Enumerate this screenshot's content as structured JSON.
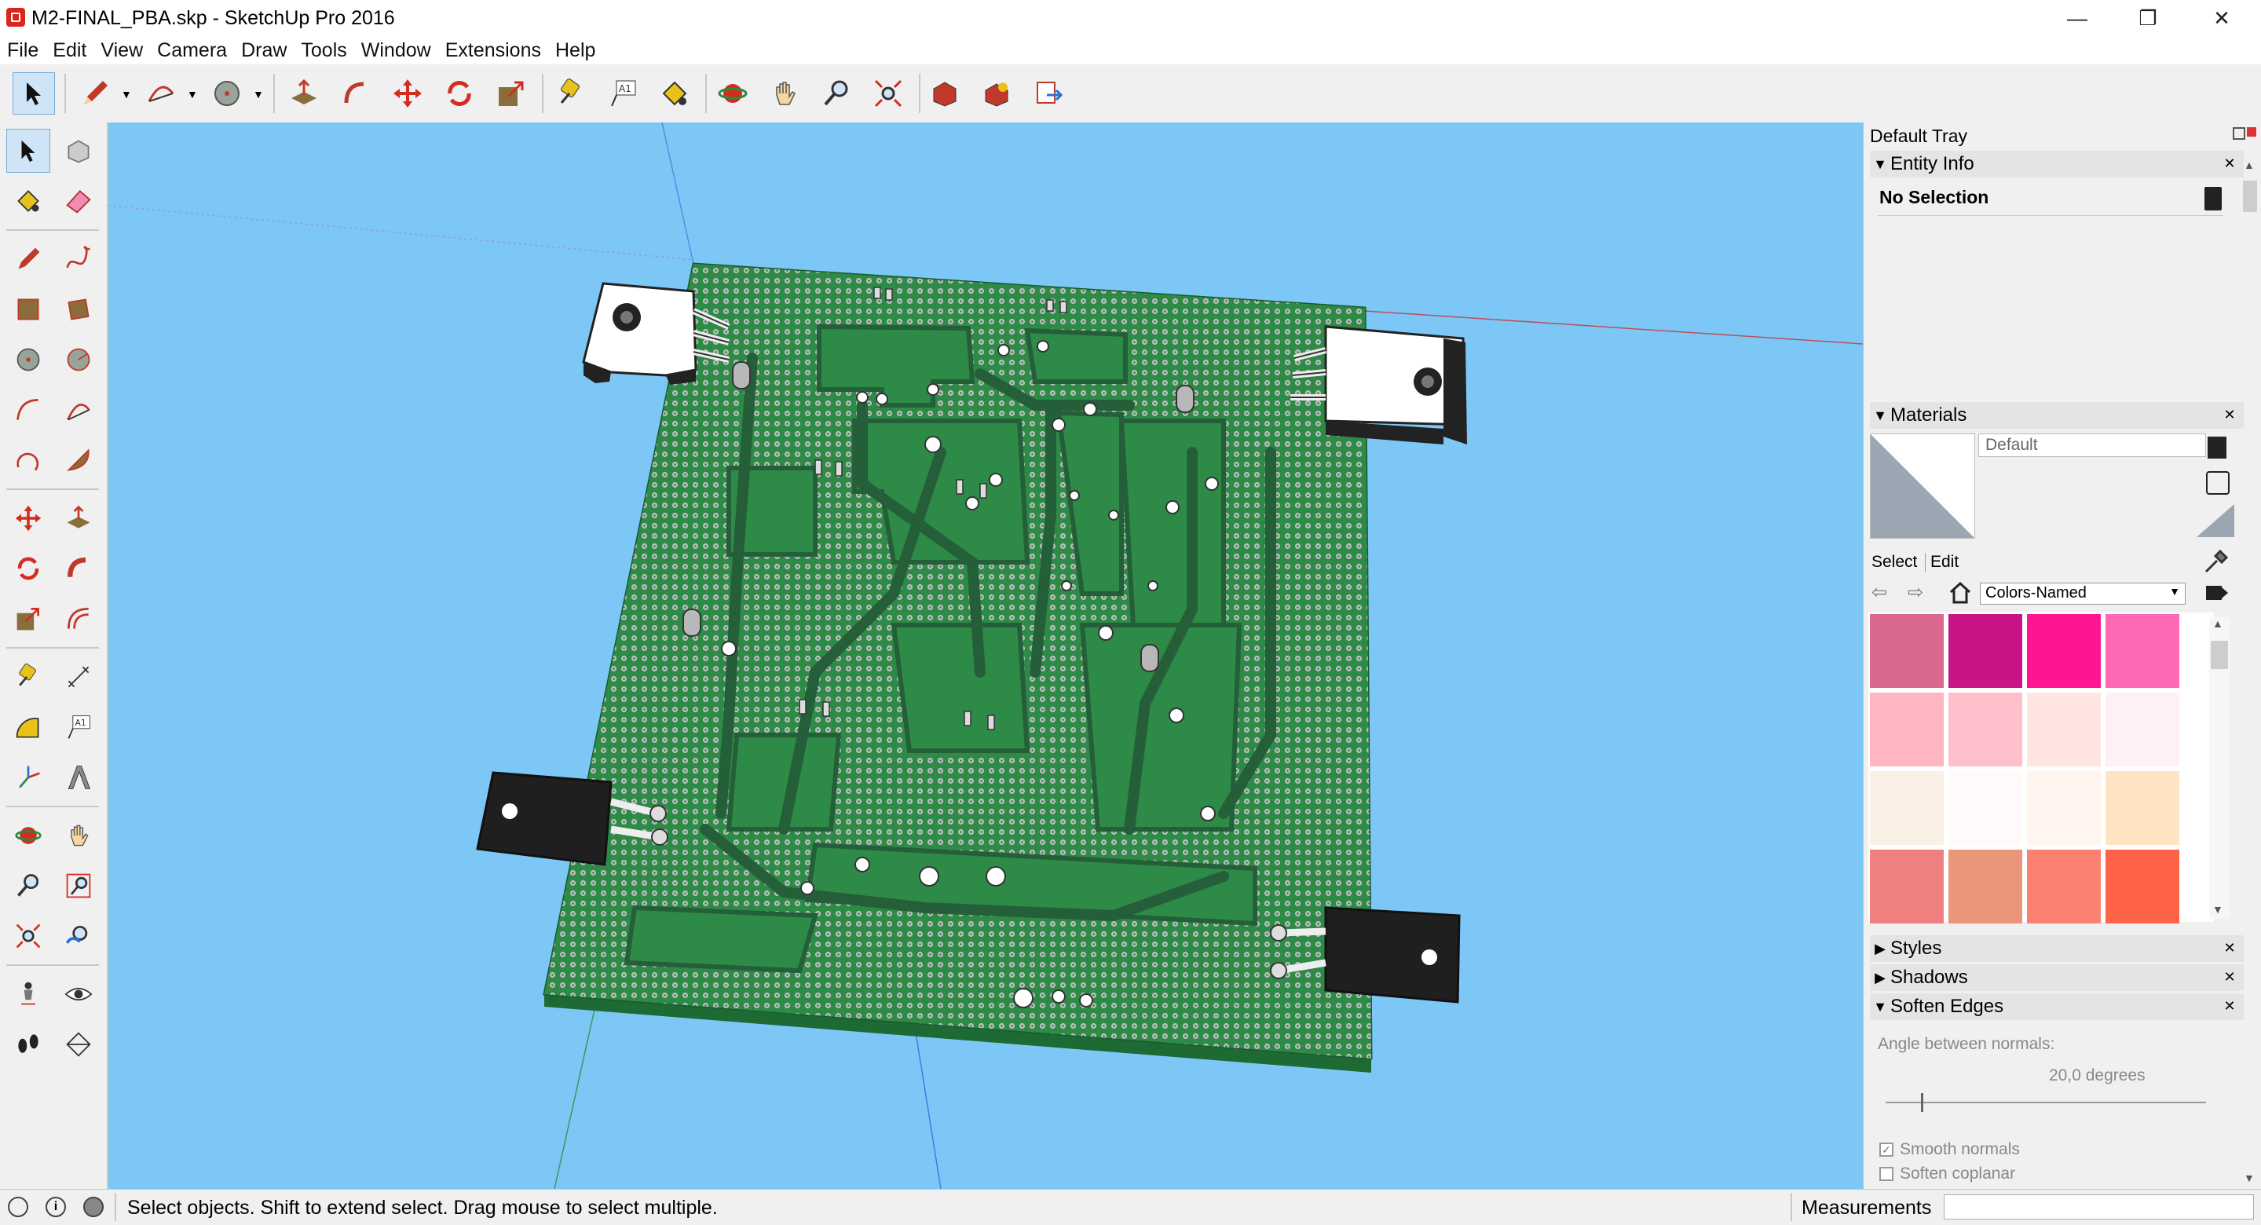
{
  "window": {
    "title": "M2-FINAL_PBA.skp - SketchUp Pro 2016",
    "minimize": "—",
    "restore": "❐",
    "close": "✕"
  },
  "menu": [
    "File",
    "Edit",
    "View",
    "Camera",
    "Draw",
    "Tools",
    "Window",
    "Extensions",
    "Help"
  ],
  "tray": {
    "title": "Default Tray",
    "entity_info": {
      "title": "Entity Info",
      "selection": "No Selection"
    },
    "materials": {
      "title": "Materials",
      "material_name": "Default",
      "tab_select": "Select",
      "tab_edit": "Edit",
      "library": "Colors-Named",
      "swatches": [
        "#d9678e",
        "#c71585",
        "#ff1493",
        "#ff69b4",
        "#ffb6c1",
        "#ffc0cb",
        "#ffe4e1",
        "#fff0f5",
        "#faf0e6",
        "#fffafa",
        "#fff5ee",
        "#ffe4c4",
        "#f08080",
        "#e9967a",
        "#fa8072",
        "#ff6347"
      ]
    },
    "styles": {
      "title": "Styles"
    },
    "shadows": {
      "title": "Shadows"
    },
    "soften_edges": {
      "title": "Soften Edges",
      "angle_label": "Angle between normals:",
      "angle_value": "20,0  degrees",
      "angle_slider_fraction": 0.11,
      "smooth_normals": "Smooth normals",
      "smooth_normals_checked": true,
      "soften_coplanar": "Soften coplanar",
      "soften_coplanar_checked": false
    }
  },
  "status": {
    "message": "Select objects. Shift to extend select. Drag mouse to select multiple.",
    "measurements_label": "Measurements",
    "measurements_value": ""
  },
  "colors": {
    "viewport_bg": "#7cc7f5",
    "pcb_green": "#2e8a47",
    "pcb_dark": "#1d6a35",
    "accent": "#d9261c"
  }
}
